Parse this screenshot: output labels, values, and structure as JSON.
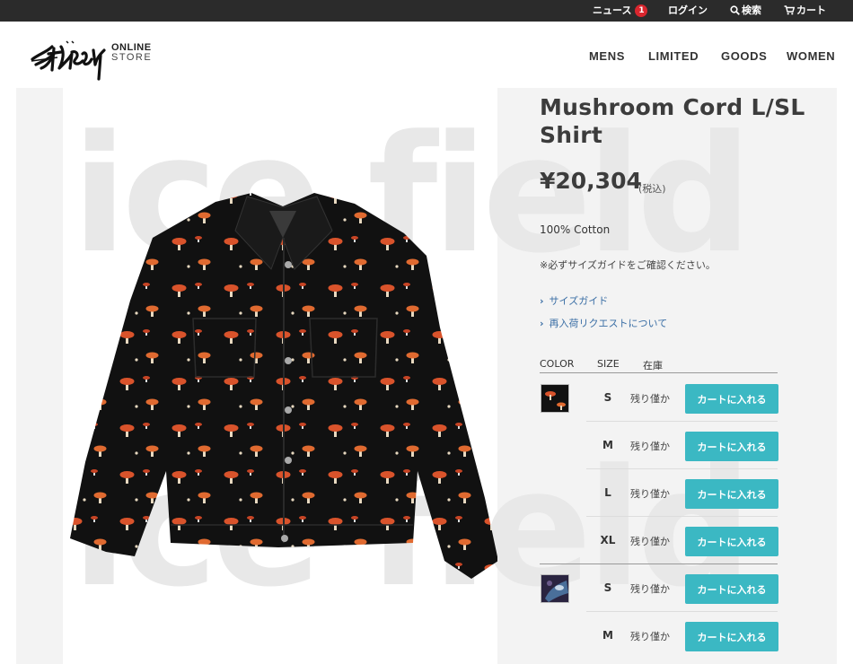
{
  "topbar": {
    "news_label": "ニュース",
    "news_badge": "1",
    "login_label": "ログイン",
    "search_label": "検索",
    "cart_label": "カート"
  },
  "header": {
    "logo_sub_line1": "ONLINE",
    "logo_sub_line2": "STORE",
    "nav": [
      "MENS",
      "LIMITED",
      "GOODS",
      "WOMEN"
    ]
  },
  "watermark": {
    "line1": "ice field",
    "line2": "ice field"
  },
  "product": {
    "title": "Mushroom Cord L/SL Shirt",
    "price": "¥20,304",
    "tax_note": "(税込)",
    "material": "100% Cotton",
    "size_notice": "※必ずサイズガイドをご確認ください。",
    "size_guide_link": "サイズガイド",
    "restock_link": "再入荷リクエストについて"
  },
  "variants_table": {
    "col_color": "COLOR",
    "col_size": "SIZE",
    "col_stock": "在庫",
    "rows": [
      {
        "color": "black-mushroom",
        "size": "S",
        "stock": "残り僅か",
        "button": "カートに入れる"
      },
      {
        "color": "black-mushroom",
        "size": "M",
        "stock": "残り僅か",
        "button": "カートに入れる"
      },
      {
        "color": "black-mushroom",
        "size": "L",
        "stock": "残り僅か",
        "button": "カートに入れる"
      },
      {
        "color": "black-mushroom",
        "size": "XL",
        "stock": "残り僅か",
        "button": "カートに入れる"
      },
      {
        "color": "navy-print",
        "size": "S",
        "stock": "残り僅か",
        "button": "カートに入れる"
      },
      {
        "color": "navy-print",
        "size": "M",
        "stock": "残り僅か",
        "button": "カートに入れる"
      }
    ]
  },
  "colors": {
    "topbar_bg": "#2b2b2b",
    "badge": "#d9262e",
    "cart_button": "#3bb8c3",
    "link": "#3a6ea5"
  }
}
